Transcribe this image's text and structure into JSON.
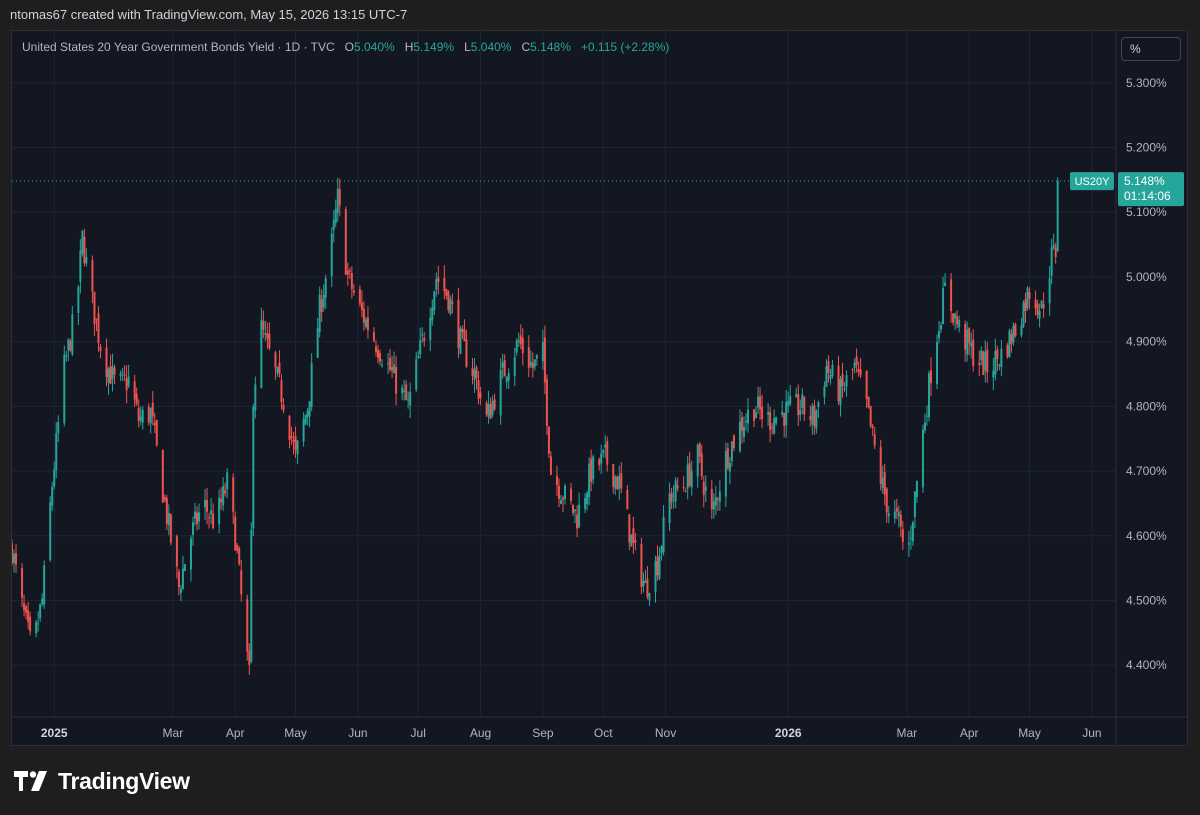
{
  "header": {
    "caption": "ntomas67 created with TradingView.com, May 15, 2026 13:15 UTC-7"
  },
  "legend": {
    "symbol_desc": "United States 20 Year Government Bonds Yield · 1D · TVC",
    "o_label": "O",
    "o_value": "5.040%",
    "h_label": "H",
    "h_value": "5.149%",
    "l_label": "L",
    "l_value": "5.040%",
    "c_label": "C",
    "c_value": "5.148%",
    "change": "+0.115 (+2.28%)"
  },
  "unit_selector": {
    "label": "%"
  },
  "brand": {
    "name": "TradingView"
  },
  "colors": {
    "up": "#26a69a",
    "down": "#ef5350",
    "background": "#131722",
    "grid": "#1f2433",
    "text": "#b2b5be"
  },
  "chart_data": {
    "type": "candlestick",
    "symbol": "US20Y",
    "interval": "1D",
    "source": "TVC",
    "y_unit": "%",
    "ylim": [
      4.32,
      5.38
    ],
    "yticks": [
      {
        "value": 4.4,
        "label": "4.400%"
      },
      {
        "value": 4.5,
        "label": "4.500%"
      },
      {
        "value": 4.6,
        "label": "4.600%"
      },
      {
        "value": 4.7,
        "label": "4.700%"
      },
      {
        "value": 4.8,
        "label": "4.800%"
      },
      {
        "value": 4.9,
        "label": "4.900%"
      },
      {
        "value": 5.0,
        "label": "5.000%"
      },
      {
        "value": 5.1,
        "label": "5.100%"
      },
      {
        "value": 5.2,
        "label": "5.200%"
      },
      {
        "value": 5.3,
        "label": "5.300%"
      }
    ],
    "xlim": [
      "2024-12-11",
      "2026-06-13"
    ],
    "xticks": [
      {
        "date": "2025-01-01",
        "label": "2025",
        "bold": true
      },
      {
        "date": "2025-03-01",
        "label": "Mar"
      },
      {
        "date": "2025-04-01",
        "label": "Apr"
      },
      {
        "date": "2025-05-01",
        "label": "May"
      },
      {
        "date": "2025-06-01",
        "label": "Jun"
      },
      {
        "date": "2025-07-01",
        "label": "Jul"
      },
      {
        "date": "2025-08-01",
        "label": "Aug"
      },
      {
        "date": "2025-09-01",
        "label": "Sep"
      },
      {
        "date": "2025-10-01",
        "label": "Oct"
      },
      {
        "date": "2025-11-01",
        "label": "Nov"
      },
      {
        "date": "2026-01-01",
        "label": "2026",
        "bold": true
      },
      {
        "date": "2026-03-01",
        "label": "Mar"
      },
      {
        "date": "2026-04-01",
        "label": "Apr"
      },
      {
        "date": "2026-05-01",
        "label": "May"
      },
      {
        "date": "2026-06-01",
        "label": "Jun"
      }
    ],
    "closes": [
      {
        "date": "2024-12-11",
        "value": 4.58
      },
      {
        "date": "2024-12-16",
        "value": 4.49
      },
      {
        "date": "2024-12-21",
        "value": 4.42
      },
      {
        "date": "2024-12-26",
        "value": 4.5
      },
      {
        "date": "2024-12-31",
        "value": 4.68
      },
      {
        "date": "2025-01-06",
        "value": 4.86
      },
      {
        "date": "2025-01-12",
        "value": 4.95
      },
      {
        "date": "2025-01-15",
        "value": 5.06
      },
      {
        "date": "2025-01-20",
        "value": 4.96
      },
      {
        "date": "2025-01-25",
        "value": 4.88
      },
      {
        "date": "2025-02-01",
        "value": 4.83
      },
      {
        "date": "2025-02-07",
        "value": 4.84
      },
      {
        "date": "2025-02-12",
        "value": 4.78
      },
      {
        "date": "2025-02-18",
        "value": 4.79
      },
      {
        "date": "2025-02-25",
        "value": 4.65
      },
      {
        "date": "2025-03-04",
        "value": 4.52
      },
      {
        "date": "2025-03-10",
        "value": 4.6
      },
      {
        "date": "2025-03-16",
        "value": 4.65
      },
      {
        "date": "2025-03-22",
        "value": 4.62
      },
      {
        "date": "2025-03-28",
        "value": 4.68
      },
      {
        "date": "2025-04-01",
        "value": 4.6
      },
      {
        "date": "2025-04-06",
        "value": 4.44
      },
      {
        "date": "2025-04-08",
        "value": 4.38
      },
      {
        "date": "2025-04-10",
        "value": 4.82
      },
      {
        "date": "2025-04-14",
        "value": 4.92
      },
      {
        "date": "2025-04-20",
        "value": 4.86
      },
      {
        "date": "2025-04-26",
        "value": 4.8
      },
      {
        "date": "2025-05-01",
        "value": 4.72
      },
      {
        "date": "2025-05-07",
        "value": 4.8
      },
      {
        "date": "2025-05-13",
        "value": 4.95
      },
      {
        "date": "2025-05-19",
        "value": 5.05
      },
      {
        "date": "2025-05-22",
        "value": 5.12
      },
      {
        "date": "2025-05-27",
        "value": 5.0
      },
      {
        "date": "2025-06-02",
        "value": 4.95
      },
      {
        "date": "2025-06-10",
        "value": 4.9
      },
      {
        "date": "2025-06-18",
        "value": 4.85
      },
      {
        "date": "2025-06-26",
        "value": 4.8
      },
      {
        "date": "2025-07-03",
        "value": 4.9
      },
      {
        "date": "2025-07-10",
        "value": 5.0
      },
      {
        "date": "2025-07-16",
        "value": 4.97
      },
      {
        "date": "2025-07-22",
        "value": 4.9
      },
      {
        "date": "2025-07-29",
        "value": 4.85
      },
      {
        "date": "2025-08-04",
        "value": 4.78
      },
      {
        "date": "2025-08-12",
        "value": 4.85
      },
      {
        "date": "2025-08-20",
        "value": 4.9
      },
      {
        "date": "2025-08-27",
        "value": 4.86
      },
      {
        "date": "2025-09-01",
        "value": 4.88
      },
      {
        "date": "2025-09-05",
        "value": 4.7
      },
      {
        "date": "2025-09-12",
        "value": 4.66
      },
      {
        "date": "2025-09-18",
        "value": 4.63
      },
      {
        "date": "2025-09-25",
        "value": 4.7
      },
      {
        "date": "2025-10-02",
        "value": 4.72
      },
      {
        "date": "2025-10-09",
        "value": 4.68
      },
      {
        "date": "2025-10-16",
        "value": 4.58
      },
      {
        "date": "2025-10-22",
        "value": 4.52
      },
      {
        "date": "2025-10-28",
        "value": 4.56
      },
      {
        "date": "2025-11-03",
        "value": 4.66
      },
      {
        "date": "2025-11-10",
        "value": 4.68
      },
      {
        "date": "2025-11-17",
        "value": 4.72
      },
      {
        "date": "2025-11-24",
        "value": 4.63
      },
      {
        "date": "2025-12-01",
        "value": 4.72
      },
      {
        "date": "2025-12-08",
        "value": 4.77
      },
      {
        "date": "2025-12-15",
        "value": 4.8
      },
      {
        "date": "2025-12-22",
        "value": 4.78
      },
      {
        "date": "2025-12-30",
        "value": 4.79
      },
      {
        "date": "2026-01-07",
        "value": 4.8
      },
      {
        "date": "2026-01-14",
        "value": 4.78
      },
      {
        "date": "2026-01-20",
        "value": 4.86
      },
      {
        "date": "2026-01-27",
        "value": 4.82
      },
      {
        "date": "2026-02-03",
        "value": 4.86
      },
      {
        "date": "2026-02-09",
        "value": 4.8
      },
      {
        "date": "2026-02-15",
        "value": 4.7
      },
      {
        "date": "2026-02-20",
        "value": 4.64
      },
      {
        "date": "2026-02-25",
        "value": 4.62
      },
      {
        "date": "2026-03-01",
        "value": 4.56
      },
      {
        "date": "2026-03-05",
        "value": 4.66
      },
      {
        "date": "2026-03-09",
        "value": 4.76
      },
      {
        "date": "2026-03-14",
        "value": 4.88
      },
      {
        "date": "2026-03-20",
        "value": 4.98
      },
      {
        "date": "2026-03-27",
        "value": 4.92
      },
      {
        "date": "2026-04-03",
        "value": 4.88
      },
      {
        "date": "2026-04-10",
        "value": 4.86
      },
      {
        "date": "2026-04-17",
        "value": 4.88
      },
      {
        "date": "2026-04-24",
        "value": 4.92
      },
      {
        "date": "2026-05-01",
        "value": 4.98
      },
      {
        "date": "2026-05-07",
        "value": 4.95
      },
      {
        "date": "2026-05-12",
        "value": 5.03
      },
      {
        "date": "2026-05-14",
        "value": 5.04
      },
      {
        "date": "2026-05-15",
        "value": 5.148
      }
    ],
    "last": {
      "symbol": "US20Y",
      "value": 5.148,
      "value_label": "5.148%",
      "countdown": "01:14:06"
    }
  }
}
